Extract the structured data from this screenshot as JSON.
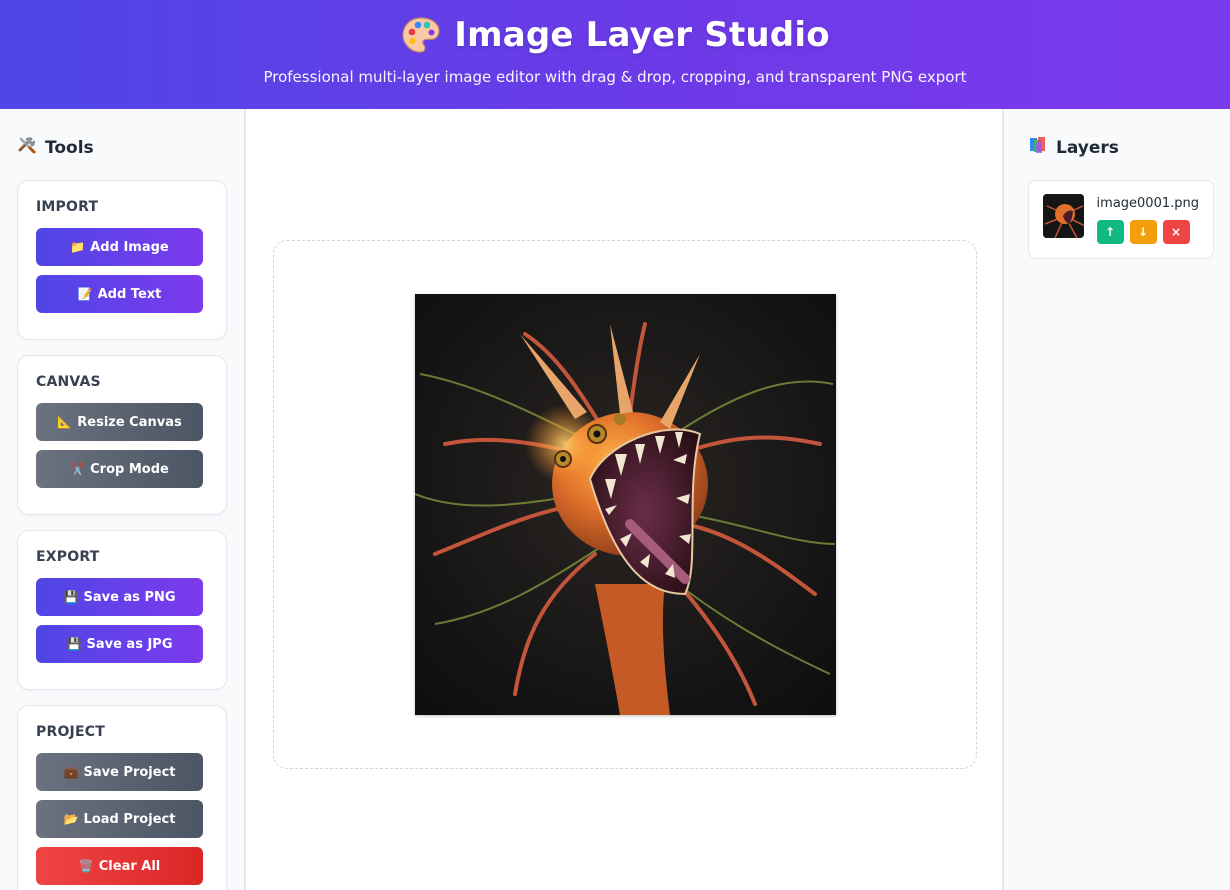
{
  "header": {
    "icon": "palette-icon",
    "title": "Image Layer Studio",
    "subtitle": "Professional multi-layer image editor with drag & drop, cropping, and transparent PNG export"
  },
  "tools": {
    "title": "Tools",
    "icon": "tools-icon",
    "groups": [
      {
        "title": "IMPORT",
        "buttons": [
          {
            "label": "Add Image",
            "icon": "folder-icon"
          },
          {
            "label": "Add Text",
            "icon": "memo-icon"
          }
        ]
      },
      {
        "title": "CANVAS",
        "buttons": [
          {
            "label": "Resize Canvas",
            "icon": "triangle-ruler-icon"
          },
          {
            "label": "Crop Mode",
            "icon": "scissors-icon"
          }
        ]
      },
      {
        "title": "EXPORT",
        "buttons": [
          {
            "label": "Save as PNG",
            "icon": "floppy-disk-icon"
          },
          {
            "label": "Save as JPG",
            "icon": "floppy-disk-icon"
          }
        ]
      },
      {
        "title": "PROJECT",
        "buttons": [
          {
            "label": "Save Project",
            "icon": "briefcase-icon"
          },
          {
            "label": "Load Project",
            "icon": "open-folder-icon"
          },
          {
            "label": "Clear All",
            "icon": "trash-icon"
          }
        ]
      }
    ]
  },
  "layers": {
    "title": "Layers",
    "icon": "layers-icon",
    "items": [
      {
        "name": "image0001.png",
        "actions": [
          "↑",
          "↓",
          "×"
        ]
      }
    ]
  },
  "colors": {
    "header_gradient": [
      "#4f46e5",
      "#7c3aed"
    ],
    "primary": "#4f46e5",
    "gray": "#6b7280",
    "danger": "#ef4444",
    "move_up": "#10b981",
    "move_down": "#f59e0b"
  }
}
